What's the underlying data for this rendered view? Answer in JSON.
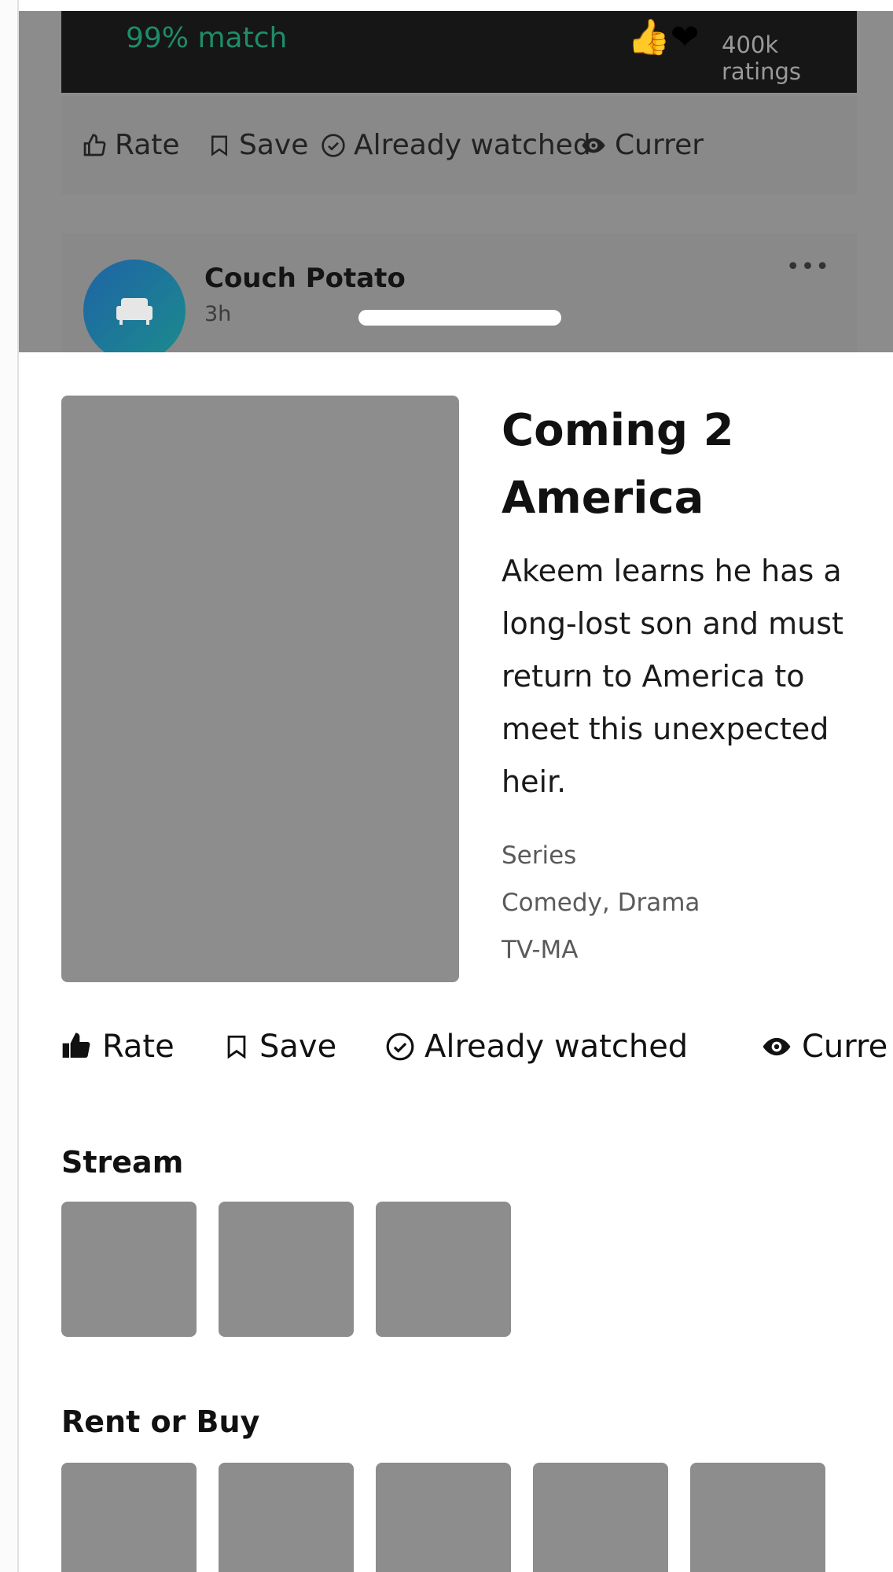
{
  "background_feed": {
    "hero": {
      "match": "99% match",
      "reaction_emoji": "👍❤",
      "ratings": "400k ratings"
    },
    "actions": [
      {
        "label": "Rate",
        "icon": "thumbs-up-outline-icon"
      },
      {
        "label": "Save",
        "icon": "bookmark-icon"
      },
      {
        "label": "Already watched",
        "icon": "check-circle-icon"
      },
      {
        "label": "Currer",
        "icon": "eye-icon"
      }
    ],
    "post": {
      "author": "Couch Potato",
      "time": "3h",
      "avatar_icon": "couch-icon",
      "menu": "•••"
    }
  },
  "details": {
    "title": "Coming 2 America",
    "description": "Akeem learns he has a long-lost son and must return to America to meet this unexpected heir.",
    "type": "Series",
    "genres": "Comedy, Drama",
    "rating": "TV-MA"
  },
  "actions": [
    {
      "label": "Rate",
      "icon": "thumbs-up-filled-icon"
    },
    {
      "label": "Save",
      "icon": "bookmark-icon"
    },
    {
      "label": "Already watched",
      "icon": "check-circle-icon"
    },
    {
      "label": "Curre",
      "icon": "eye-icon"
    }
  ],
  "stream": {
    "title": "Stream",
    "provider_count": 3
  },
  "rent_or_buy": {
    "title": "Rent or Buy",
    "provider_count": 5
  },
  "colors": {
    "match_green": "#1e8c69",
    "scrim": "#8c8c8c",
    "placeholder": "#8d8d8d"
  }
}
